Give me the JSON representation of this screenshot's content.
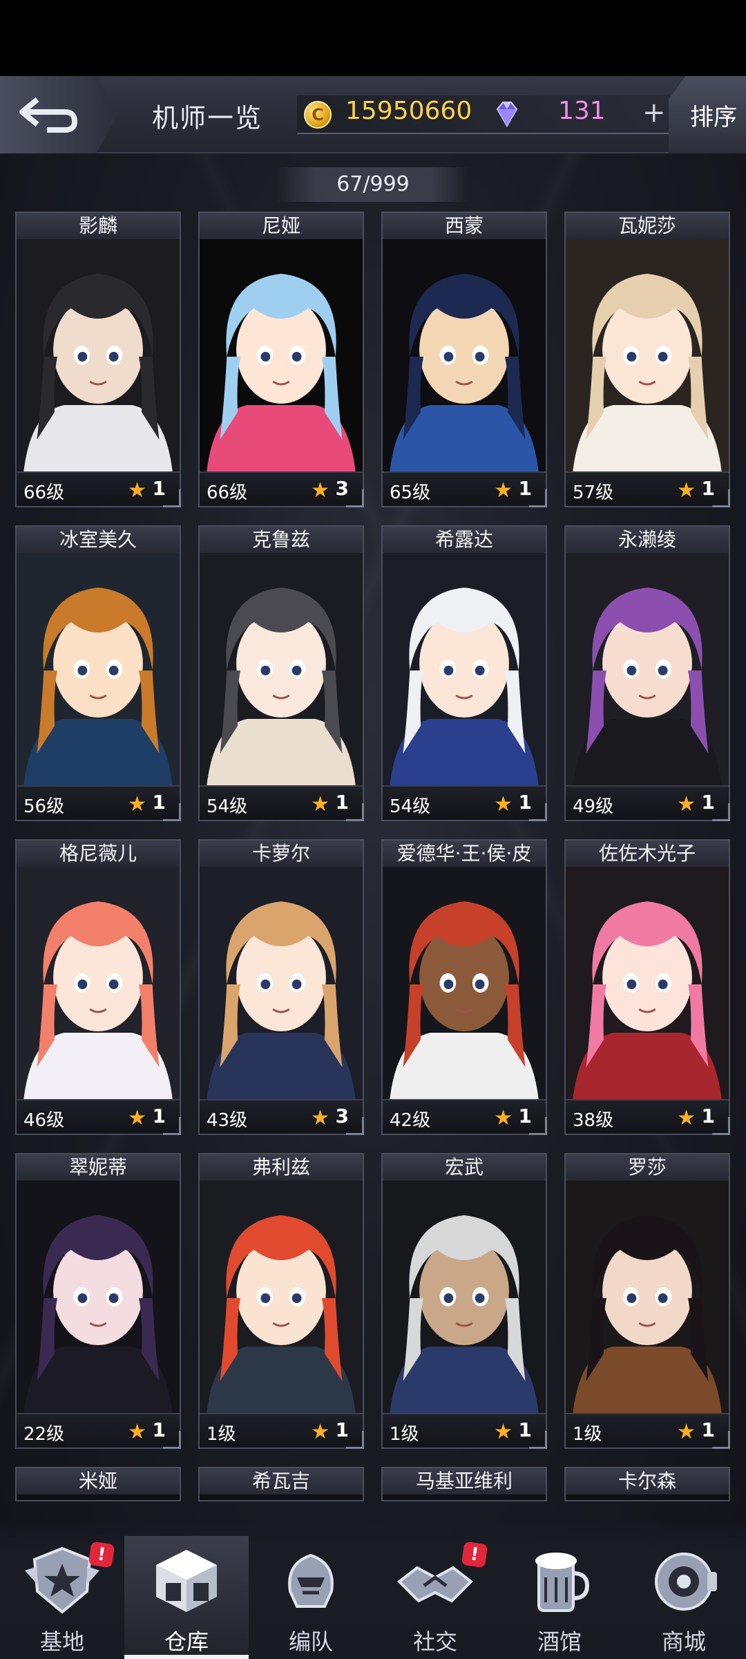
{
  "header": {
    "title": "机师一览",
    "coins": "15950660",
    "gems": "131",
    "plus": "+",
    "sort_label": "排序",
    "coin_symbol": "C"
  },
  "count": "67/999",
  "pilots": [
    {
      "name": "影麟",
      "level": "66级",
      "stars": "1",
      "hair": "#2a2a2e",
      "skin": "#efdccd",
      "outfit": "#e8e8ec",
      "bg": "#1b1b20"
    },
    {
      "name": "尼娅",
      "level": "66级",
      "stars": "3",
      "hair": "#9fcff0",
      "skin": "#fde6d6",
      "outfit": "#e84b7a",
      "bg": "#0a0a0a"
    },
    {
      "name": "西蒙",
      "level": "65级",
      "stars": "1",
      "hair": "#1c2a52",
      "skin": "#f3d7b5",
      "outfit": "#2b56a8",
      "bg": "#0d0d12"
    },
    {
      "name": "瓦妮莎",
      "level": "57级",
      "stars": "1",
      "hair": "#e6cfae",
      "skin": "#fbe6d6",
      "outfit": "#f3efe6",
      "bg": "#2a2520"
    },
    {
      "name": "冰室美久",
      "level": "56级",
      "stars": "1",
      "hair": "#c97a2a",
      "skin": "#fbe0c6",
      "outfit": "#1e3e66",
      "bg": "#20262f"
    },
    {
      "name": "克鲁兹",
      "level": "54级",
      "stars": "1",
      "hair": "#4a4a50",
      "skin": "#fbe8dc",
      "outfit": "#eadfcf",
      "bg": "#1a1c22"
    },
    {
      "name": "希露达",
      "level": "54级",
      "stars": "1",
      "hair": "#eef0f4",
      "skin": "#fbe6d8",
      "outfit": "#2a3f8e",
      "bg": "#1b1e27"
    },
    {
      "name": "永濑绫",
      "level": "49级",
      "stars": "1",
      "hair": "#8c4fb0",
      "skin": "#f6ddd0",
      "outfit": "#1a1a1e",
      "bg": "#1e1e24"
    },
    {
      "name": "格尼薇儿",
      "level": "46级",
      "stars": "1",
      "hair": "#f2806a",
      "skin": "#fce6da",
      "outfit": "#f2f0f6",
      "bg": "#22222a"
    },
    {
      "name": "卡萝尔",
      "level": "43级",
      "stars": "3",
      "hair": "#d9a56c",
      "skin": "#fbe6d8",
      "outfit": "#28345a",
      "bg": "#1c1e28"
    },
    {
      "name": "爱德华·王·侯·皮",
      "level": "42级",
      "stars": "1",
      "hair": "#c7402a",
      "skin": "#8a5a3a",
      "outfit": "#efefef",
      "bg": "#15161b"
    },
    {
      "name": "佐佐木光子",
      "level": "38级",
      "stars": "1",
      "hair": "#f07aa2",
      "skin": "#fde4da",
      "outfit": "#a8262e",
      "bg": "#1e1a1e"
    },
    {
      "name": "翠妮蒂",
      "level": "22级",
      "stars": "1",
      "hair": "#3a2a52",
      "skin": "#f4dde0",
      "outfit": "#1c1a24",
      "bg": "#14131a"
    },
    {
      "name": "弗利兹",
      "level": "1级",
      "stars": "1",
      "hair": "#e14a2e",
      "skin": "#fbe3d2",
      "outfit": "#2c3848",
      "bg": "#1a1c22"
    },
    {
      "name": "宏武",
      "level": "1级",
      "stars": "1",
      "hair": "#d8d8d8",
      "skin": "#c8a888",
      "outfit": "#2a3a6a",
      "bg": "#17181c"
    },
    {
      "name": "罗莎",
      "level": "1级",
      "stars": "1",
      "hair": "#1a1418",
      "skin": "#f2d8c8",
      "outfit": "#7a4a2a",
      "bg": "#1a1818"
    }
  ],
  "partial_row": [
    "米娅",
    "希瓦吉",
    "马基亚维利",
    "卡尔森"
  ],
  "nav": [
    {
      "label": "基地",
      "icon": "base-icon",
      "badge": "!",
      "active": false
    },
    {
      "label": "仓库",
      "icon": "warehouse-icon",
      "badge": "",
      "active": true
    },
    {
      "label": "编队",
      "icon": "formation-icon",
      "badge": "",
      "active": false
    },
    {
      "label": "社交",
      "icon": "social-icon",
      "badge": "!",
      "active": false
    },
    {
      "label": "酒馆",
      "icon": "tavern-icon",
      "badge": "",
      "active": false
    },
    {
      "label": "商城",
      "icon": "shop-icon",
      "badge": "",
      "active": false
    }
  ],
  "colors": {
    "star": "#ffb01e",
    "coin": "#ffd24a",
    "gem": "#f28ce8",
    "badge": "#e3263a"
  }
}
